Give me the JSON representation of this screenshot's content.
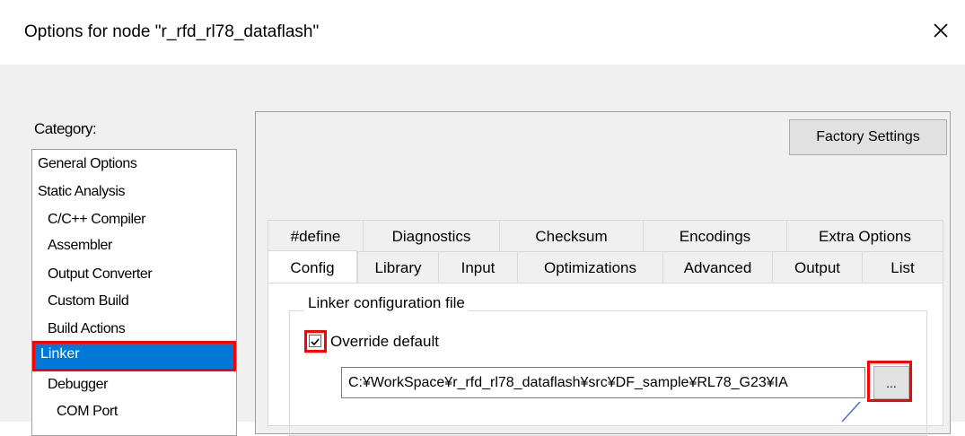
{
  "window": {
    "title": "Options for node \"r_rfd_rl78_dataflash\"",
    "close_icon": "close-icon"
  },
  "category": {
    "label": "Category:",
    "items": [
      {
        "label": "General Options"
      },
      {
        "label": "Static Analysis"
      },
      {
        "label": "C/C++ Compiler"
      },
      {
        "label": "Assembler"
      },
      {
        "label": "Output Converter"
      },
      {
        "label": "Custom Build"
      },
      {
        "label": "Build Actions"
      },
      {
        "label": "Linker"
      },
      {
        "label": "Debugger"
      },
      {
        "label": "COM Port"
      }
    ],
    "selected": "Linker"
  },
  "panel": {
    "factory_button": "Factory Settings",
    "tabs_row1": [
      "#define",
      "Diagnostics",
      "Checksum",
      "Encodings",
      "Extra Options"
    ],
    "tabs_row2": [
      "Config",
      "Library",
      "Input",
      "Optimizations",
      "Advanced",
      "Output",
      "List"
    ],
    "active_tab": "Config",
    "group_title": "Linker configuration file",
    "override_label": "Override default",
    "override_checked": true,
    "path_value": "C:¥WorkSpace¥r_rfd_rl78_dataflash¥src¥DF_sample¥RL78_G23¥IA",
    "browse_label": "..."
  },
  "colors": {
    "selection": "#0078d7",
    "highlight": "#ff0000",
    "callout": "#4472c4"
  }
}
